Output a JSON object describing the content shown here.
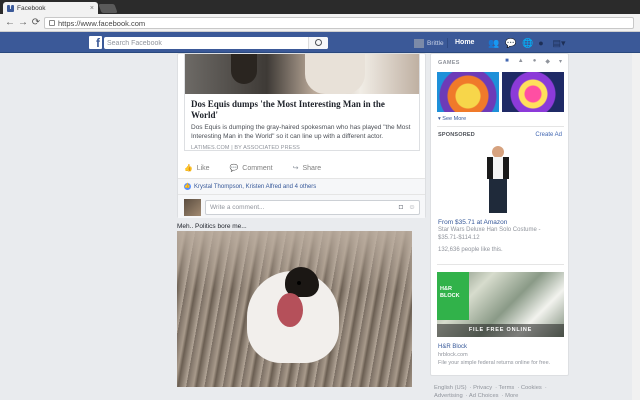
{
  "browser": {
    "tab_title": "Facebook",
    "tab_close": "×",
    "back": "←",
    "forward": "→",
    "reload": "⟳",
    "url": "https://www.facebook.com"
  },
  "header": {
    "logo": "f",
    "search_placeholder": "Search Facebook",
    "username": "Brittle",
    "home_label": "Home"
  },
  "post1": {
    "link_title": "Dos Equis dumps 'the Most Interesting Man in the World'",
    "link_desc": "Dos Equis is dumping the gray-haired spokesman who has played \"the Most Interesting Man in the World\" so it can line up with a different actor.",
    "link_source": "LATIMES.COM | BY ASSOCIATED PRESS",
    "like_label": "Like",
    "comment_label": "Comment",
    "share_label": "Share",
    "reactions_text": "Krystal Thompson, Kristen Alfred and 4 others",
    "comment_placeholder": "Write a comment..."
  },
  "post2": {
    "status": "Meh.. Politics bore me..."
  },
  "sidebar": {
    "games_heading": "GAMES",
    "see_more": "See More",
    "sponsored_heading": "SPONSORED",
    "create_ad": "Create Ad",
    "ad1": {
      "title": "From $35.71 at Amazon",
      "desc": "Star Wars Deluxe Han Solo Costume - $35.71-$114.12",
      "likes": "132,636 people like this."
    },
    "ad2": {
      "logo_text": "H&R BLOCK",
      "banner": "FILE FREE ONLINE",
      "name": "H&R Block",
      "url": "hrblock.com",
      "desc": "File your simple federal returns online for free."
    }
  },
  "footer": {
    "links": [
      "English (US)",
      "Privacy",
      "Terms",
      "Cookies",
      "Advertising",
      "Ad Choices",
      "More"
    ]
  },
  "colors": {
    "fb_blue": "#3b5998",
    "link_blue": "#365899",
    "background": "#e9ebee"
  }
}
